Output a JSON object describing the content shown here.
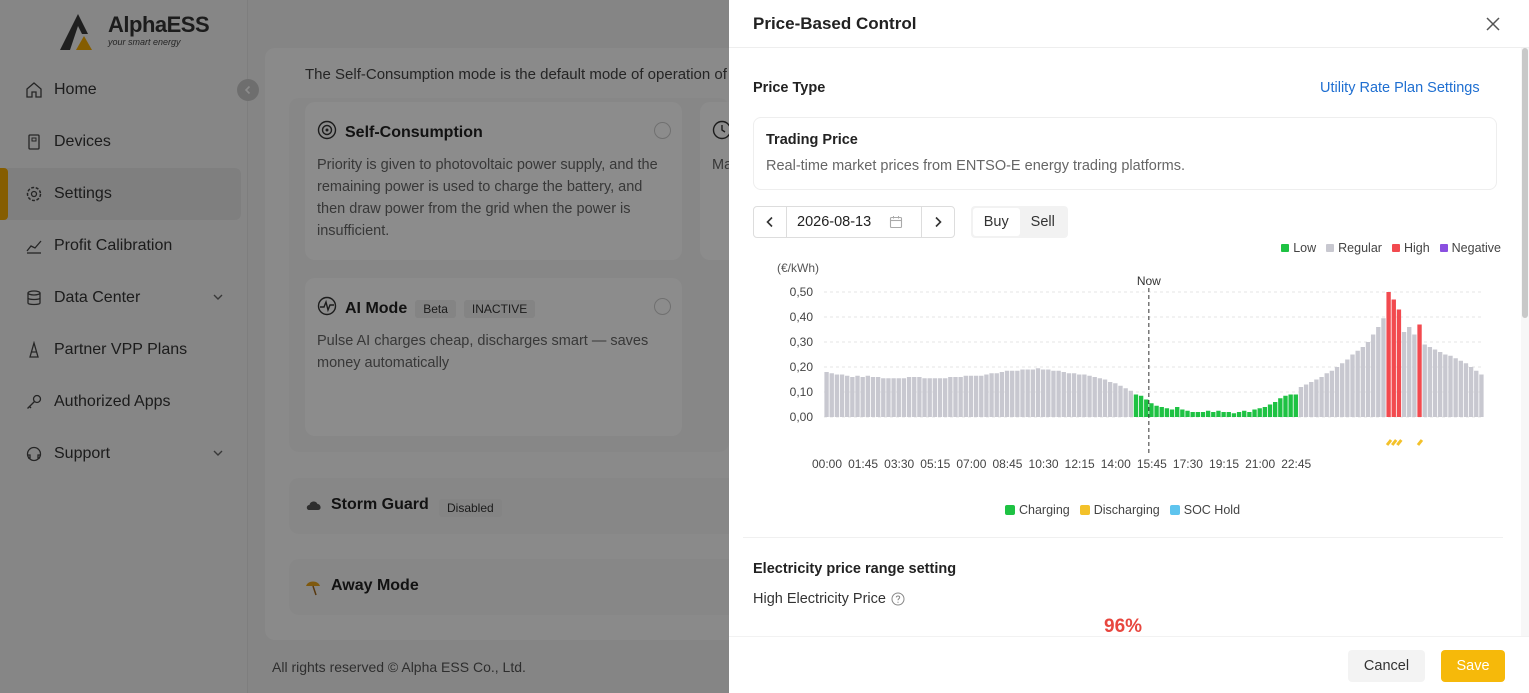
{
  "app": {
    "brand": "AlphaESS",
    "brand_tagline": "your smart energy",
    "nav": [
      {
        "label": "Home",
        "icon": "home-icon"
      },
      {
        "label": "Devices",
        "icon": "device-icon"
      },
      {
        "label": "Settings",
        "icon": "gear-icon",
        "active": true
      },
      {
        "label": "Profit Calibration",
        "icon": "chart-icon"
      },
      {
        "label": "Data Center",
        "icon": "database-icon",
        "expandable": true
      },
      {
        "label": "Partner VPP Plans",
        "icon": "partner-icon"
      },
      {
        "label": "Authorized Apps",
        "icon": "key-icon"
      },
      {
        "label": "Support",
        "icon": "support-icon",
        "expandable": true
      }
    ],
    "intro": "The Self-Consumption mode is the default mode of operation of",
    "modes": {
      "self_consumption": {
        "title": "Self-Consumption",
        "desc": "Priority is given to photovoltaic power supply, and the remaining power is used to charge the battery, and then draw power from the grid when the power is insufficient."
      },
      "ai_mode": {
        "title": "AI Mode",
        "tag1": "Beta",
        "tag2": "INACTIVE",
        "desc": "Pulse AI charges cheap, discharges smart — saves money automatically"
      },
      "partial_card_text": "Ma"
    },
    "storm_guard": {
      "title": "Storm Guard",
      "status": "Disabled"
    },
    "away_mode": {
      "title": "Away Mode"
    },
    "footer": "All rights reserved © Alpha ESS Co., Ltd."
  },
  "drawer": {
    "title": "Price-Based Control",
    "price_type_label": "Price Type",
    "rate_plan_link": "Utility Rate Plan Settings",
    "trading_price_title": "Trading Price",
    "trading_price_desc": "Real-time market prices from ENTSO-E energy trading platforms.",
    "date": "2026-08-13",
    "segment": {
      "buy": "Buy",
      "sell": "Sell",
      "selected": "Buy"
    },
    "legend_top": [
      {
        "label": "Low",
        "color": "#1ec243"
      },
      {
        "label": "Regular",
        "color": "#c8c8d0"
      },
      {
        "label": "High",
        "color": "#f24a4f"
      },
      {
        "label": "Negative",
        "color": "#8a4fe0"
      }
    ],
    "legend_bottom": [
      {
        "label": "Charging",
        "color": "#1ec243"
      },
      {
        "label": "Discharging",
        "color": "#f3c12a"
      },
      {
        "label": "SOC Hold",
        "color": "#5ec4ee"
      }
    ],
    "range_title": "Electricity price range setting",
    "high_price_label": "High Electricity Price",
    "high_price_pct": "96%",
    "cancel": "Cancel",
    "save": "Save"
  },
  "chart_data": {
    "type": "bar",
    "unit_label": "(€/kWh)",
    "now_label": "Now",
    "now_time": "15:45",
    "ylim": [
      0,
      0.5
    ],
    "y_ticks": [
      "0,00",
      "0,10",
      "0,20",
      "0,30",
      "0,40",
      "0,50"
    ],
    "x_tick_labels": [
      "00:00",
      "01:45",
      "03:30",
      "05:15",
      "07:00",
      "08:45",
      "10:30",
      "12:15",
      "14:00",
      "15:45",
      "17:30",
      "19:15",
      "21:00",
      "22:45"
    ],
    "interval_minutes": 15,
    "values": [
      0.18,
      0.175,
      0.17,
      0.17,
      0.165,
      0.16,
      0.165,
      0.16,
      0.165,
      0.16,
      0.16,
      0.155,
      0.155,
      0.155,
      0.155,
      0.155,
      0.16,
      0.16,
      0.16,
      0.155,
      0.155,
      0.155,
      0.155,
      0.155,
      0.16,
      0.16,
      0.16,
      0.165,
      0.165,
      0.165,
      0.165,
      0.17,
      0.175,
      0.175,
      0.18,
      0.185,
      0.185,
      0.185,
      0.19,
      0.19,
      0.19,
      0.195,
      0.19,
      0.19,
      0.185,
      0.185,
      0.18,
      0.175,
      0.175,
      0.17,
      0.17,
      0.165,
      0.16,
      0.155,
      0.15,
      0.14,
      0.135,
      0.125,
      0.115,
      0.105,
      0.09,
      0.085,
      0.07,
      0.055,
      0.045,
      0.04,
      0.035,
      0.03,
      0.04,
      0.03,
      0.025,
      0.02,
      0.02,
      0.02,
      0.025,
      0.02,
      0.025,
      0.02,
      0.02,
      0.015,
      0.02,
      0.025,
      0.02,
      0.03,
      0.035,
      0.04,
      0.05,
      0.06,
      0.075,
      0.085,
      0.09,
      0.09,
      0.12,
      0.13,
      0.14,
      0.15,
      0.16,
      0.175,
      0.185,
      0.2,
      0.215,
      0.23,
      0.25,
      0.265,
      0.28,
      0.3,
      0.33,
      0.36,
      0.395,
      0.5,
      0.47,
      0.43,
      0.34,
      0.36,
      0.33,
      0.37,
      0.29,
      0.28,
      0.27,
      0.26,
      0.25,
      0.245,
      0.235,
      0.225,
      0.215,
      0.2,
      0.185,
      0.17
    ],
    "categories_low_range": [
      54,
      91
    ],
    "categories_high": [
      109,
      110,
      111,
      115
    ],
    "discharging_slots": [
      109,
      110,
      111,
      115
    ]
  }
}
